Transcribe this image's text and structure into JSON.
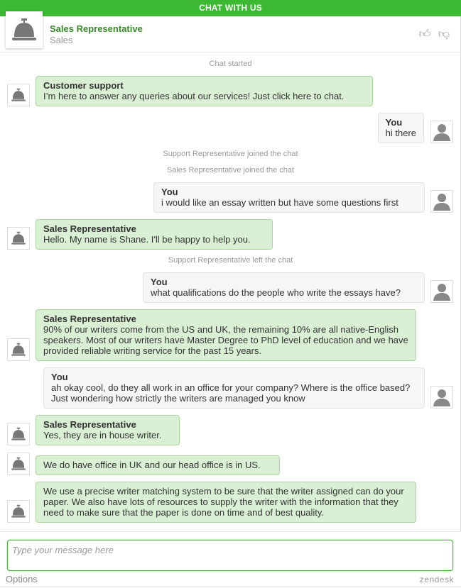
{
  "title": "CHAT WITH US",
  "agent": {
    "name": "Sales Representative",
    "department": "Sales",
    "avatar_icon": "service-bell-icon"
  },
  "rating": {
    "up_icon": "thumbs-up-icon",
    "down_icon": "thumbs-down-icon"
  },
  "colors": {
    "brand": "#3cb832",
    "agent_bubble": "#d9f0d4",
    "agent_name": "#3a8a2a"
  },
  "messages": [
    {
      "type": "system",
      "text": "Chat started"
    },
    {
      "type": "agent",
      "name": "Customer support",
      "text": "I’m here to answer any queries about our services! Just click here to chat."
    },
    {
      "type": "you",
      "name": "You",
      "text": "hi there"
    },
    {
      "type": "system",
      "text": "Support Representative joined the chat"
    },
    {
      "type": "system",
      "text": "Sales Representative joined the chat"
    },
    {
      "type": "you",
      "name": "You",
      "text": "i would like an essay written but have some questions first"
    },
    {
      "type": "agent",
      "name": "Sales Representative",
      "text": "Hello. My name is Shane. I'll be happy to help you."
    },
    {
      "type": "system",
      "text": "Support Representative left the chat"
    },
    {
      "type": "you",
      "name": "You",
      "text": "what qualifications do the people who write the essays have?"
    },
    {
      "type": "agent",
      "name": "Sales Representative",
      "text": "90% of our writers come from the US and UK, the remaining 10% are all native-English speakers. Most of our writers have Master Degree to PhD level of education and we have provided reliable writing service for the past 15 years."
    },
    {
      "type": "you",
      "name": "You",
      "text": "ah okay cool, do they all work in an office for your company? Where is the office based? Just wondering how strictly the writers are managed you know"
    },
    {
      "type": "agent",
      "name": "Sales Representative",
      "text": "Yes, they are in house writer."
    },
    {
      "type": "agent",
      "name": "",
      "text": "We do have office in UK and our head office is in US."
    },
    {
      "type": "agent",
      "name": "",
      "text": "We use a precise writer matching system to be sure that the writer assigned can do your paper. We also have lots of resources to supply the writer with the information that they need to make sure that the paper is done on time and of best quality."
    }
  ],
  "composer": {
    "placeholder": "Type your message here",
    "value": ""
  },
  "footer": {
    "options_label": "Options",
    "brand": "zendesk"
  }
}
